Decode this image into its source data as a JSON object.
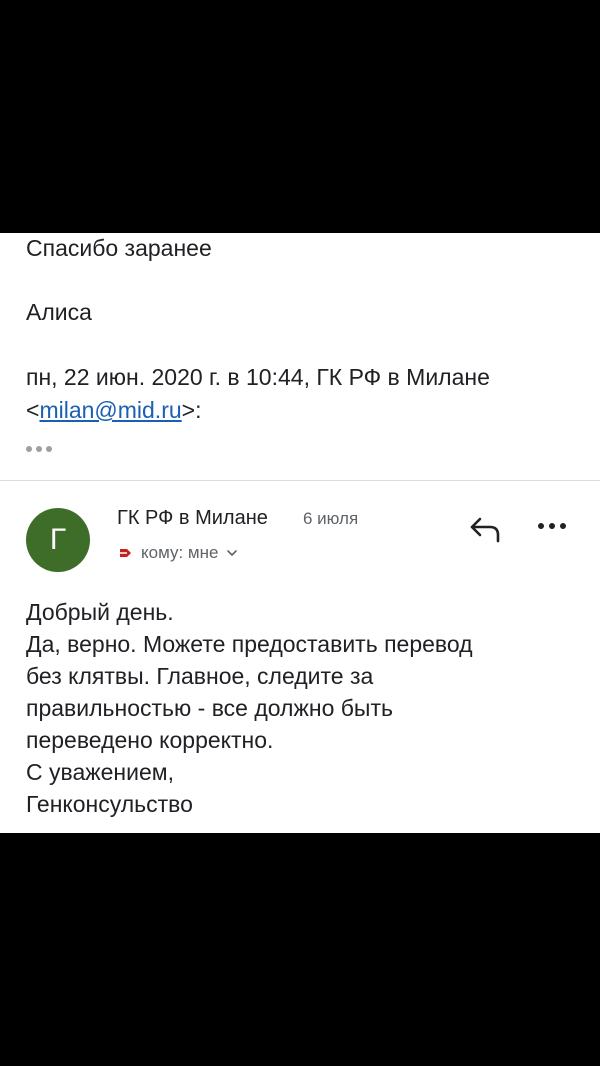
{
  "quoted": {
    "thanks_line": "Спасибо заранее",
    "signature": "Алиса",
    "attribution_text": "пн, 22 июн. 2020 г. в 10:44, ГК РФ в Милане",
    "attribution_open": "<",
    "attribution_email": "milan@mid.ru",
    "attribution_close": ">:"
  },
  "message": {
    "avatar_letter": "Г",
    "avatar_color": "#3e6d2a",
    "sender": "ГК РФ в Милане",
    "date": "6 июля",
    "recipient_label": "кому: мне",
    "icons": {
      "reply": "reply-arrow-icon",
      "more": "more-horizontal-icon",
      "important": "importance-marker-icon",
      "expand": "chevron-down-icon"
    },
    "body_lines": [
      "Добрый день.",
      "Да, верно. Можете предоставить перевод",
      "без клятвы. Главное, следите за",
      "правильностью - все должно быть",
      "переведено корректно.",
      "С уважением,",
      "Генконсульство"
    ]
  },
  "colors": {
    "link": "#1a5fb4",
    "important_marker": "#c5221f",
    "muted_text": "#5f6368"
  }
}
